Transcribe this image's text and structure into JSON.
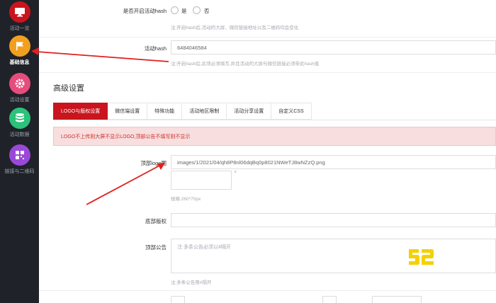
{
  "sidebar": {
    "items": [
      {
        "label": "活动一览",
        "icon": "monitor-icon",
        "color": "#c9151e"
      },
      {
        "label": "基础信息",
        "icon": "flag-icon",
        "color": "#f0a020"
      },
      {
        "label": "活动设置",
        "icon": "gear-icon",
        "color": "#e64c7c"
      },
      {
        "label": "活动数据",
        "icon": "database-icon",
        "color": "#2bc27a"
      },
      {
        "label": "链接与二维码",
        "icon": "qrcode-icon",
        "color": "#9a48d8"
      }
    ]
  },
  "form": {
    "hash_toggle": {
      "label": "是否开启活动hash",
      "opt_yes": "是",
      "opt_no": "否",
      "hint": "注:开启hash后,活动的大屏、微信链接地址以及二维码均会变化"
    },
    "hash_field": {
      "label": "活动hash",
      "value": "6484046584",
      "hint": "注:开启hash后,此项必须填写,并且活动的大屏与微信链接必须带此hash值"
    }
  },
  "section": {
    "title": "高级设置"
  },
  "tabs": [
    {
      "label": "LOGO与版权设置",
      "active": true
    },
    {
      "label": "微信端设置",
      "active": false
    },
    {
      "label": "特殊功能",
      "active": false
    },
    {
      "label": "活动地区限制",
      "active": false
    },
    {
      "label": "活动分享设置",
      "active": false
    },
    {
      "label": "自定义CSS",
      "active": false
    }
  ],
  "alert": {
    "text": "LOGO不上传则大屏不显示LOGO,顶部公告不填写则不显示"
  },
  "logo": {
    "label": "顶部logo图",
    "value": "images/1/2021/04/qh8P8nl06dqBq0p8021NWeTJ8wNZzQ.png",
    "preview_marker": "×",
    "size_hint": "规格:260*70px"
  },
  "copyright": {
    "label": "底部版权"
  },
  "notice": {
    "label": "顶部公告",
    "placeholder": "注:多条公告必须以#隔开",
    "hint": "注:多条公告用#隔开"
  },
  "colors": {
    "accent": "#c9151e",
    "sidebar_bg": "#20222a",
    "annotation_arrow": "#e02020",
    "watermark": "#f5d000"
  },
  "watermark": {
    "icon": "52-logo-icon"
  }
}
